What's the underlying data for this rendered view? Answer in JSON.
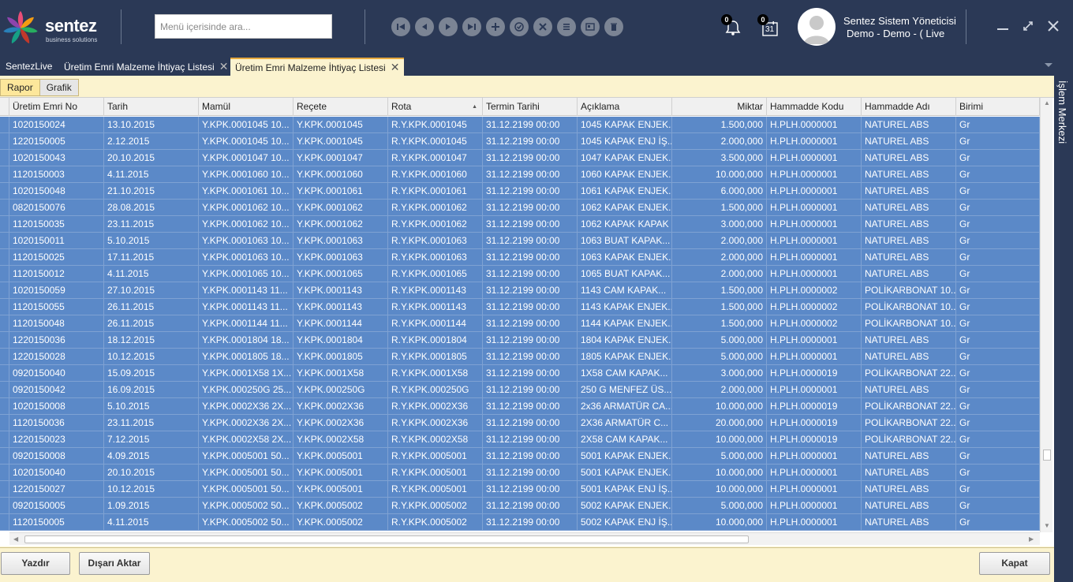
{
  "header": {
    "logo_text": "sentez",
    "logo_sub": "business solutions",
    "search_placeholder": "Menü içerisinde ara...",
    "notifications_count": "0",
    "calendar_count": "0",
    "calendar_day": "31",
    "user_name": "Sentez Sistem Yöneticisi",
    "user_company": "Demo - Demo - ( Live"
  },
  "tabs": [
    {
      "label": "SentezLive"
    },
    {
      "label": "Üretim Emri Malzeme İhtiyaç Listesi"
    },
    {
      "label": "Üretim Emri Malzeme İhtiyaç Listesi"
    }
  ],
  "subtabs": [
    "Rapor",
    "Grafik"
  ],
  "columns": [
    "Üretim Emri No",
    "Tarih",
    "Mamül",
    "Reçete",
    "Rota",
    "Termin Tarihi",
    "Açıklama",
    "Miktar",
    "Hammadde Kodu",
    "Hammadde Adı",
    "Birimi"
  ],
  "rows": [
    [
      "1020150024",
      "13.10.2015",
      "Y.KPK.0001045  10...",
      "Y.KPK.0001045",
      "R.Y.KPK.0001045",
      "31.12.2199 00:00",
      "1045 KAPAK ENJEK...",
      "1.500,000",
      "H.PLH.0000001",
      "NATUREL ABS",
      "Gr"
    ],
    [
      "1220150005",
      "2.12.2015",
      "Y.KPK.0001045  10...",
      "Y.KPK.0001045",
      "R.Y.KPK.0001045",
      "31.12.2199 00:00",
      "1045 KAPAK ENJ İŞ...",
      "2.000,000",
      "H.PLH.0000001",
      "NATUREL ABS",
      "Gr"
    ],
    [
      "1020150043",
      "20.10.2015",
      "Y.KPK.0001047  10...",
      "Y.KPK.0001047",
      "R.Y.KPK.0001047",
      "31.12.2199 00:00",
      "1047 KAPAK ENJEK...",
      "3.500,000",
      "H.PLH.0000001",
      "NATUREL ABS",
      "Gr"
    ],
    [
      "1120150003",
      "4.11.2015",
      "Y.KPK.0001060  10...",
      "Y.KPK.0001060",
      "R.Y.KPK.0001060",
      "31.12.2199 00:00",
      "1060 KAPAK ENJEK...",
      "10.000,000",
      "H.PLH.0000001",
      "NATUREL ABS",
      "Gr"
    ],
    [
      "1020150048",
      "21.10.2015",
      "Y.KPK.0001061  10...",
      "Y.KPK.0001061",
      "R.Y.KPK.0001061",
      "31.12.2199 00:00",
      "1061 KAPAK ENJEK...",
      "6.000,000",
      "H.PLH.0000001",
      "NATUREL ABS",
      "Gr"
    ],
    [
      "0820150076",
      "28.08.2015",
      "Y.KPK.0001062  10...",
      "Y.KPK.0001062",
      "R.Y.KPK.0001062",
      "31.12.2199 00:00",
      "1062 KAPAK ENJEK...",
      "1.500,000",
      "H.PLH.0000001",
      "NATUREL ABS",
      "Gr"
    ],
    [
      "1120150035",
      "23.11.2015",
      "Y.KPK.0001062  10...",
      "Y.KPK.0001062",
      "R.Y.KPK.0001062",
      "31.12.2199 00:00",
      "1062 KAPAK KAPAK",
      "3.000,000",
      "H.PLH.0000001",
      "NATUREL ABS",
      "Gr"
    ],
    [
      "1020150011",
      "5.10.2015",
      "Y.KPK.0001063  10...",
      "Y.KPK.0001063",
      "R.Y.KPK.0001063",
      "31.12.2199 00:00",
      "1063 BUAT KAPAK...",
      "2.000,000",
      "H.PLH.0000001",
      "NATUREL ABS",
      "Gr"
    ],
    [
      "1120150025",
      "17.11.2015",
      "Y.KPK.0001063  10...",
      "Y.KPK.0001063",
      "R.Y.KPK.0001063",
      "31.12.2199 00:00",
      "1063 KAPAK ENJEK...",
      "2.000,000",
      "H.PLH.0000001",
      "NATUREL ABS",
      "Gr"
    ],
    [
      "1120150012",
      "4.11.2015",
      "Y.KPK.0001065  10...",
      "Y.KPK.0001065",
      "R.Y.KPK.0001065",
      "31.12.2199 00:00",
      "1065 BUAT KAPAK...",
      "2.000,000",
      "H.PLH.0000001",
      "NATUREL ABS",
      "Gr"
    ],
    [
      "1020150059",
      "27.10.2015",
      "Y.KPK.0001143  11...",
      "Y.KPK.0001143",
      "R.Y.KPK.0001143",
      "31.12.2199 00:00",
      "1143 CAM KAPAK...",
      "1.500,000",
      "H.PLH.0000002",
      "POLİKARBONAT 10...",
      "Gr"
    ],
    [
      "1120150055",
      "26.11.2015",
      "Y.KPK.0001143  11...",
      "Y.KPK.0001143",
      "R.Y.KPK.0001143",
      "31.12.2199 00:00",
      "1143 KAPAK ENJEK...",
      "1.500,000",
      "H.PLH.0000002",
      "POLİKARBONAT 10...",
      "Gr"
    ],
    [
      "1120150048",
      "26.11.2015",
      "Y.KPK.0001144  11...",
      "Y.KPK.0001144",
      "R.Y.KPK.0001144",
      "31.12.2199 00:00",
      "1144 KAPAK ENJEK...",
      "1.500,000",
      "H.PLH.0000002",
      "POLİKARBONAT 10...",
      "Gr"
    ],
    [
      "1220150036",
      "18.12.2015",
      "Y.KPK.0001804  18...",
      "Y.KPK.0001804",
      "R.Y.KPK.0001804",
      "31.12.2199 00:00",
      "1804 KAPAK ENJEK...",
      "5.000,000",
      "H.PLH.0000001",
      "NATUREL ABS",
      "Gr"
    ],
    [
      "1220150028",
      "10.12.2015",
      "Y.KPK.0001805  18...",
      "Y.KPK.0001805",
      "R.Y.KPK.0001805",
      "31.12.2199 00:00",
      "1805 KAPAK ENJEK...",
      "5.000,000",
      "H.PLH.0000001",
      "NATUREL ABS",
      "Gr"
    ],
    [
      "0920150040",
      "15.09.2015",
      "Y.KPK.0001X58  1X...",
      "Y.KPK.0001X58",
      "R.Y.KPK.0001X58",
      "31.12.2199 00:00",
      "1X58 CAM KAPAK...",
      "3.000,000",
      "H.PLH.0000019",
      "POLİKARBONAT 22...",
      "Gr"
    ],
    [
      "0920150042",
      "16.09.2015",
      "Y.KPK.000250G  25...",
      "Y.KPK.000250G",
      "R.Y.KPK.000250G",
      "31.12.2199 00:00",
      "250 G MENFEZ ÜS...",
      "2.000,000",
      "H.PLH.0000001",
      "NATUREL ABS",
      "Gr"
    ],
    [
      "1020150008",
      "5.10.2015",
      "Y.KPK.0002X36  2X...",
      "Y.KPK.0002X36",
      "R.Y.KPK.0002X36",
      "31.12.2199 00:00",
      "2x36 ARMATÜR CA...",
      "10.000,000",
      "H.PLH.0000019",
      "POLİKARBONAT 22...",
      "Gr"
    ],
    [
      "1120150036",
      "23.11.2015",
      "Y.KPK.0002X36  2X...",
      "Y.KPK.0002X36",
      "R.Y.KPK.0002X36",
      "31.12.2199 00:00",
      "2X36 ARMATÜR C...",
      "20.000,000",
      "H.PLH.0000019",
      "POLİKARBONAT 22...",
      "Gr"
    ],
    [
      "1220150023",
      "7.12.2015",
      "Y.KPK.0002X58  2X...",
      "Y.KPK.0002X58",
      "R.Y.KPK.0002X58",
      "31.12.2199 00:00",
      "2X58 CAM KAPAK...",
      "10.000,000",
      "H.PLH.0000019",
      "POLİKARBONAT 22...",
      "Gr"
    ],
    [
      "0920150008",
      "4.09.2015",
      "Y.KPK.0005001  50...",
      "Y.KPK.0005001",
      "R.Y.KPK.0005001",
      "31.12.2199 00:00",
      "5001 KAPAK ENJEK...",
      "5.000,000",
      "H.PLH.0000001",
      "NATUREL ABS",
      "Gr"
    ],
    [
      "1020150040",
      "20.10.2015",
      "Y.KPK.0005001  50...",
      "Y.KPK.0005001",
      "R.Y.KPK.0005001",
      "31.12.2199 00:00",
      "5001 KAPAK ENJEK...",
      "10.000,000",
      "H.PLH.0000001",
      "NATUREL ABS",
      "Gr"
    ],
    [
      "1220150027",
      "10.12.2015",
      "Y.KPK.0005001  50...",
      "Y.KPK.0005001",
      "R.Y.KPK.0005001",
      "31.12.2199 00:00",
      "5001 KAPAK ENJ İŞ...",
      "10.000,000",
      "H.PLH.0000001",
      "NATUREL ABS",
      "Gr"
    ],
    [
      "0920150005",
      "1.09.2015",
      "Y.KPK.0005002  50...",
      "Y.KPK.0005002",
      "R.Y.KPK.0005002",
      "31.12.2199 00:00",
      "5002 KAPAK ENJEK...",
      "5.000,000",
      "H.PLH.0000001",
      "NATUREL ABS",
      "Gr"
    ],
    [
      "1120150005",
      "4.11.2015",
      "Y.KPK.0005002  50...",
      "Y.KPK.0005002",
      "R.Y.KPK.0005002",
      "31.12.2199 00:00",
      "5002 KAPAK ENJ İŞ...",
      "10.000,000",
      "H.PLH.0000001",
      "NATUREL ABS",
      "Gr"
    ]
  ],
  "buttons": {
    "print": "Yazdır",
    "export": "Dışarı Aktar",
    "close": "Kapat"
  },
  "side_panel_label": "İşlem Merkezi",
  "colors": {
    "header_bg": "#2b3956",
    "row_selected": "#5b89c8",
    "content_bg": "#fbf3cf",
    "active_tab_accent": "#e6a83e"
  }
}
